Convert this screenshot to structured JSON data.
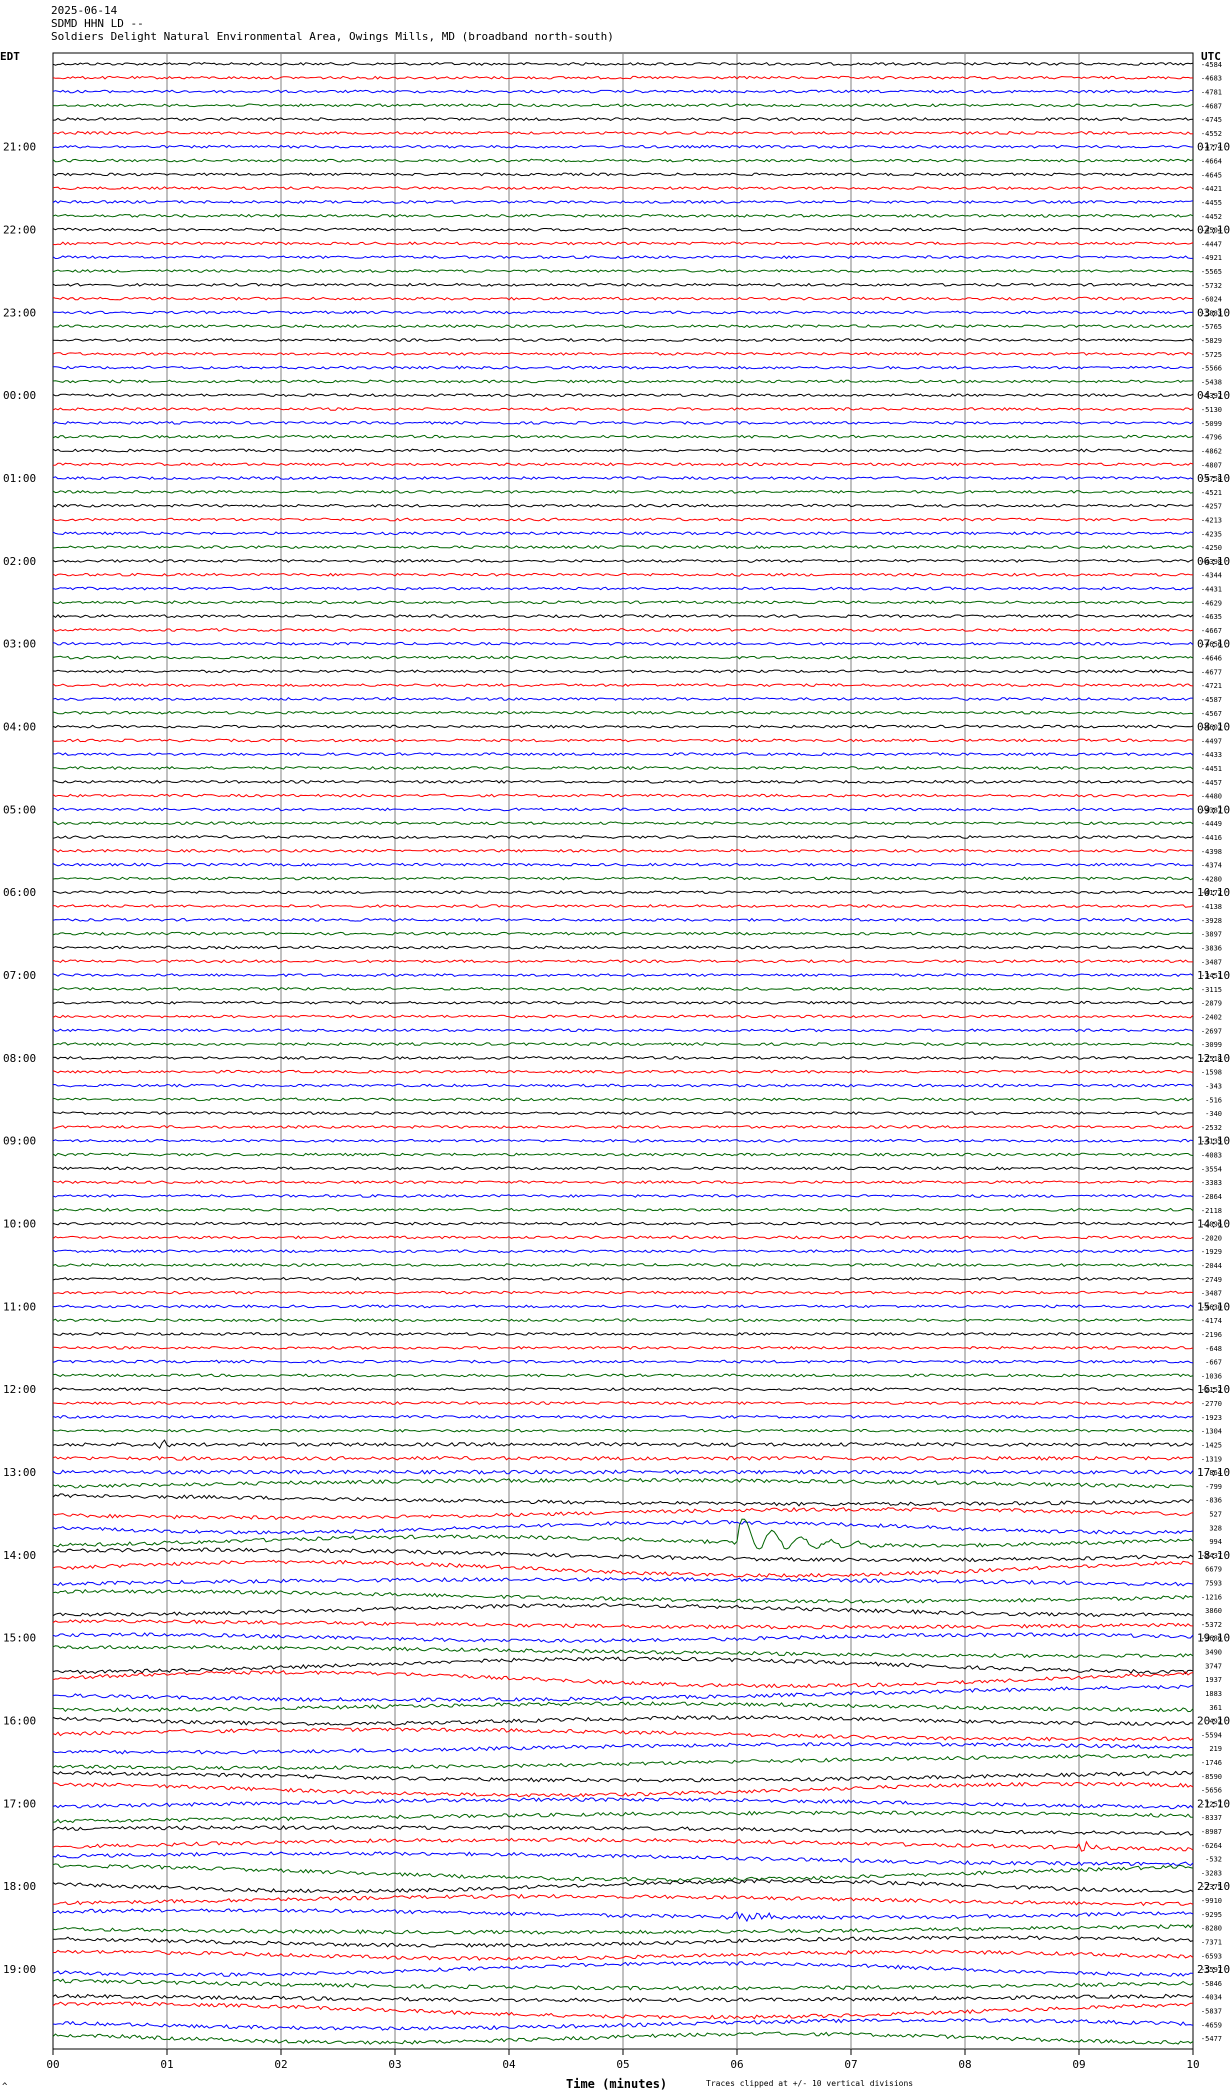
{
  "header": {
    "date": "2025-06-14",
    "channel": "SDMD HHN LD --",
    "station": "Soldiers Delight Natural Environmental Area, Owings Mills, MD (broadband north-south)"
  },
  "left_tz": "EDT",
  "right_tz": "UTC",
  "footer": {
    "xlabel": "Time (minutes)",
    "note": "Traces clipped at +/- 10 vertical divisions",
    "corner_mark": "^"
  },
  "colors": {
    "trace_cycle": [
      "#000000",
      "#ff0000",
      "#0000ff",
      "#006400"
    ],
    "grid": "#808080"
  },
  "chart_data": {
    "type": "line",
    "title": "SDMD HHN LD --",
    "xlabel": "Time (minutes)",
    "xlim": [
      0,
      10
    ],
    "x_ticks": [
      "00",
      "01",
      "02",
      "03",
      "04",
      "05",
      "06",
      "07",
      "08",
      "09",
      "10"
    ],
    "traces_per_hour": 6,
    "left_hour_labels": [
      "21:00",
      "22:00",
      "23:00",
      "00:00",
      "01:00",
      "02:00",
      "03:00",
      "04:00",
      "05:00",
      "06:00",
      "07:00",
      "08:00",
      "09:00",
      "10:00",
      "11:00",
      "12:00",
      "13:00",
      "14:00",
      "15:00",
      "16:00",
      "17:00",
      "18:00",
      "19:00"
    ],
    "right_hour_labels": [
      "01:10",
      "02:10",
      "03:10",
      "04:10",
      "05:10",
      "06:10",
      "07:10",
      "08:10",
      "09:10",
      "10:10",
      "11:10",
      "12:10",
      "13:10",
      "14:10",
      "15:10",
      "16:10",
      "17:10",
      "18:10",
      "19:10",
      "20:10",
      "21:10",
      "22:10",
      "23:10"
    ],
    "trace_offsets": [
      "-4584",
      "-4683",
      "-4781",
      "-4687",
      "-4745",
      "-4552",
      "-4774",
      "-4664",
      "-4645",
      "-4421",
      "-4455",
      "-4452",
      "-4504",
      "-4447",
      "-4921",
      "-5565",
      "-5732",
      "-6024",
      "-5883",
      "-5765",
      "-5829",
      "-5725",
      "-5566",
      "-5438",
      "-5392",
      "-5130",
      "-5099",
      "-4796",
      "-4862",
      "-4807",
      "-4758",
      "-4521",
      "-4257",
      "-4213",
      "-4235",
      "-4250",
      "-4398",
      "-4344",
      "-4431",
      "-4629",
      "-4635",
      "-4667",
      "-4656",
      "-4646",
      "-4677",
      "-4721",
      "-4587",
      "-4567",
      "-4602",
      "-4497",
      "-4433",
      "-4451",
      "-4457",
      "-4480",
      "-4387",
      "-4449",
      "-4416",
      "-4398",
      "-4374",
      "-4280",
      "-4172",
      "-4138",
      "-3928",
      "-3897",
      "-3836",
      "-3487",
      "-3451",
      "-3115",
      "-2879",
      "-2402",
      "-2697",
      "-3099",
      "-2518",
      "-1598",
      "-343",
      "-516",
      "-340",
      "-2532",
      "-4135",
      "-4083",
      "-3554",
      "-3383",
      "-2864",
      "-2118",
      "-2096",
      "-2020",
      "-1929",
      "-2044",
      "-2749",
      "-3487",
      "-4630",
      "-4174",
      "-2196",
      "-648",
      "-667",
      "-1036",
      "-2152",
      "-2770",
      "-1923",
      "-1304",
      "-1425",
      "-1319",
      "864",
      "-799",
      "-836",
      "527",
      "328",
      "994",
      "-2437",
      "6679",
      "7593",
      "-1216",
      "3860",
      "-5372",
      "-3686",
      "3490",
      "3747",
      "1937",
      "1883",
      "361",
      "492",
      "-5594",
      "219",
      "-1746",
      "-8590",
      "-5656",
      "-7257",
      "-8337",
      "-8987",
      "-6264",
      "-532",
      "-3283",
      "-7375",
      "-9910",
      "-9295",
      "-8280",
      "-7371",
      "-6593",
      "-5597",
      "-5846",
      "-4034",
      "-5837",
      "-4659",
      "-5477"
    ],
    "events": [
      {
        "trace_index": 100,
        "minute": 0.95,
        "kind": "spike"
      },
      {
        "trace_index": 107,
        "minute": 6.0,
        "kind": "earthquake"
      },
      {
        "trace_index": 129,
        "minute": 9.05,
        "kind": "spike"
      },
      {
        "trace_index": 134,
        "minute": 6.1,
        "kind": "burst"
      }
    ]
  }
}
